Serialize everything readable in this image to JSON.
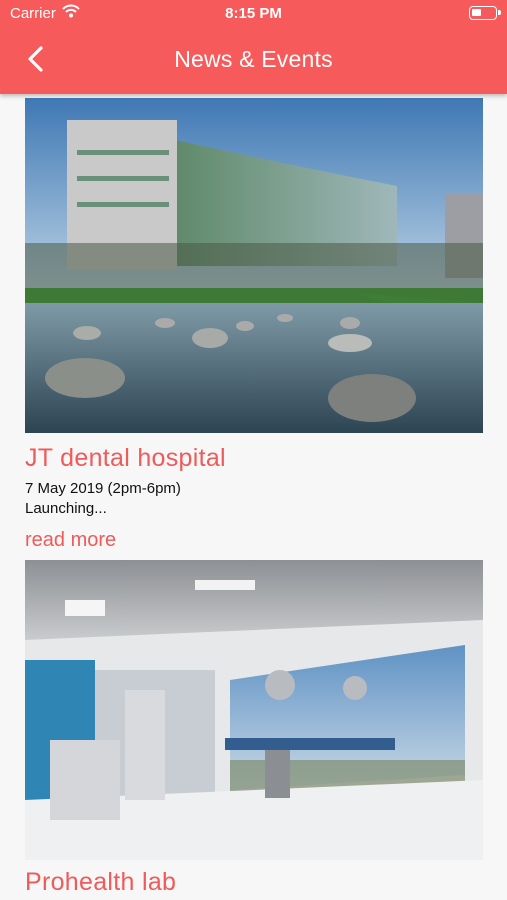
{
  "status_bar": {
    "carrier": "Carrier",
    "time": "8:15 PM"
  },
  "header": {
    "title": "News & Events"
  },
  "icons": {
    "back": "chevron-left-icon",
    "wifi": "wifi-icon",
    "battery": "battery-icon"
  },
  "colors": {
    "accent": "#f75a5a",
    "link": "#ef5a5a"
  },
  "events": [
    {
      "title": "JT dental hospital",
      "date": "7 May 2019 (2pm-6pm)",
      "summary": "Launching...",
      "link": "read more"
    },
    {
      "title": "Prohealth lab"
    }
  ]
}
